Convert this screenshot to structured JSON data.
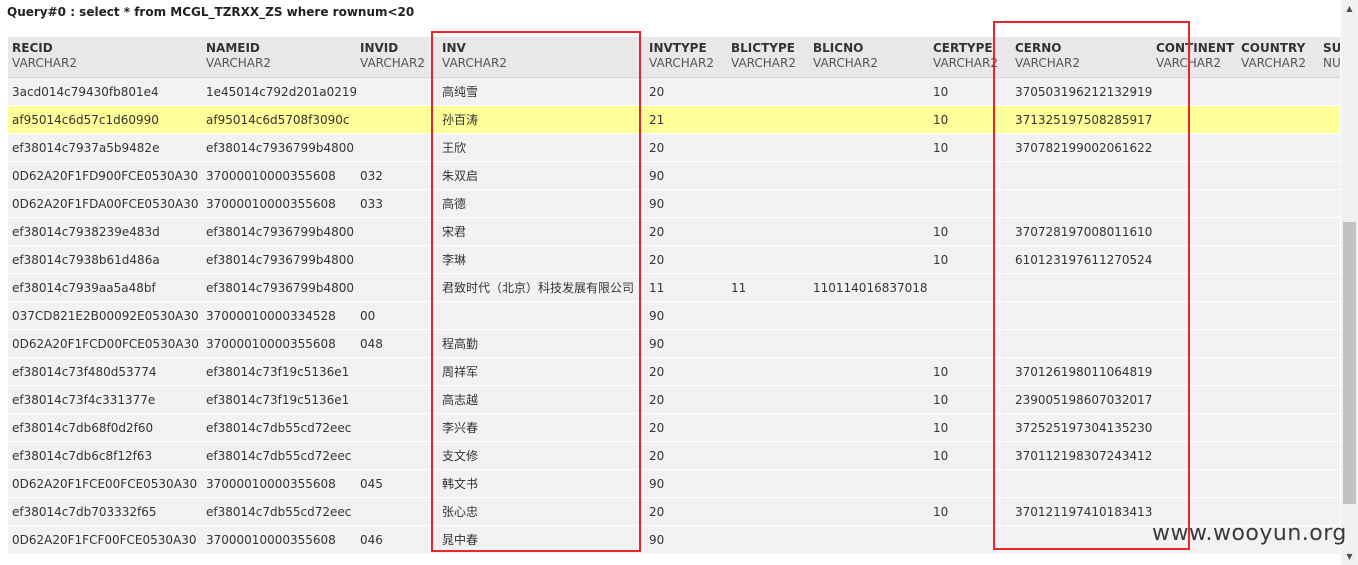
{
  "query": {
    "title": "Query#0 : select * from MCGL_TZRXX_ZS where rownum<20"
  },
  "columns": [
    {
      "name": "RECID",
      "type": "VARCHAR2"
    },
    {
      "name": "NAMEID",
      "type": "VARCHAR2"
    },
    {
      "name": "INVID",
      "type": "VARCHAR2"
    },
    {
      "name": "INV",
      "type": "VARCHAR2"
    },
    {
      "name": "INVTYPE",
      "type": "VARCHAR2"
    },
    {
      "name": "BLICTYPE",
      "type": "VARCHAR2"
    },
    {
      "name": "BLICNO",
      "type": "VARCHAR2"
    },
    {
      "name": "CERTYPE",
      "type": "VARCHAR2"
    },
    {
      "name": "CERNO",
      "type": "VARCHAR2"
    },
    {
      "name": "CONTINENT",
      "type": "VARCHAR2"
    },
    {
      "name": "COUNTRY",
      "type": "VARCHAR2"
    },
    {
      "name": "SU",
      "type": "NU"
    }
  ],
  "rows": [
    [
      "3acd014c79430fb801e4",
      "1e45014c792d201a0219",
      "",
      "高纯雪",
      "20",
      "",
      "",
      "10",
      "370503196212132919",
      "",
      "",
      ""
    ],
    [
      "af95014c6d57c1d60990",
      "af95014c6d5708f3090c",
      "",
      "孙百涛",
      "21",
      "",
      "",
      "10",
      "371325197508285917",
      "",
      "",
      ""
    ],
    [
      "ef38014c7937a5b9482e",
      "ef38014c7936799b4800",
      "",
      "王欣",
      "20",
      "",
      "",
      "10",
      "370782199002061622",
      "",
      "",
      ""
    ],
    [
      "0D62A20F1FD900FCE0530A30",
      "37000010000355608",
      "032",
      "朱双启",
      "90",
      "",
      "",
      "",
      "",
      "",
      "",
      ""
    ],
    [
      "0D62A20F1FDA00FCE0530A30",
      "37000010000355608",
      "033",
      "高德",
      "90",
      "",
      "",
      "",
      "",
      "",
      "",
      ""
    ],
    [
      "ef38014c7938239e483d",
      "ef38014c7936799b4800",
      "",
      "宋君",
      "20",
      "",
      "",
      "10",
      "370728197008011610",
      "",
      "",
      ""
    ],
    [
      "ef38014c7938b61d486a",
      "ef38014c7936799b4800",
      "",
      "李琳",
      "20",
      "",
      "",
      "10",
      "610123197611270524",
      "",
      "",
      ""
    ],
    [
      "ef38014c7939aa5a48bf",
      "ef38014c7936799b4800",
      "",
      "君致时代（北京）科技发展有限公司",
      "11",
      "11",
      "110114016837018",
      "",
      "",
      "",
      "",
      ""
    ],
    [
      "037CD821E2B00092E0530A30",
      "37000010000334528",
      "00",
      "",
      "90",
      "",
      "",
      "",
      "",
      "",
      "",
      ""
    ],
    [
      "0D62A20F1FCD00FCE0530A30",
      "37000010000355608",
      "048",
      "程高勤",
      "90",
      "",
      "",
      "",
      "",
      "",
      "",
      ""
    ],
    [
      "ef38014c73f480d53774",
      "ef38014c73f19c5136e1",
      "",
      "周祥军",
      "20",
      "",
      "",
      "10",
      "370126198011064819",
      "",
      "",
      ""
    ],
    [
      "ef38014c73f4c331377e",
      "ef38014c73f19c5136e1",
      "",
      "高志越",
      "20",
      "",
      "",
      "10",
      "239005198607032017",
      "",
      "",
      ""
    ],
    [
      "ef38014c7db68f0d2f60",
      "ef38014c7db55cd72eec",
      "",
      "李兴春",
      "20",
      "",
      "",
      "10",
      "372525197304135230",
      "",
      "",
      ""
    ],
    [
      "ef38014c7db6c8f12f63",
      "ef38014c7db55cd72eec",
      "",
      "支文修",
      "20",
      "",
      "",
      "10",
      "370112198307243412",
      "",
      "",
      ""
    ],
    [
      "0D62A20F1FCE00FCE0530A30",
      "37000010000355608",
      "045",
      "韩文书",
      "90",
      "",
      "",
      "",
      "",
      "",
      "",
      ""
    ],
    [
      "ef38014c7db703332f65",
      "ef38014c7db55cd72eec",
      "",
      "张心忠",
      "20",
      "",
      "",
      "10",
      "370121197410183413",
      "",
      "",
      ""
    ],
    [
      "0D62A20F1FCF00FCE0530A30",
      "37000010000355608",
      "046",
      "晁中春",
      "90",
      "",
      "",
      "",
      "",
      "",
      "",
      ""
    ]
  ],
  "highlight_row": 1,
  "highlight_color": "#ffff99",
  "annotation_color": "#e8262b",
  "watermark": "www.wooyun.org"
}
